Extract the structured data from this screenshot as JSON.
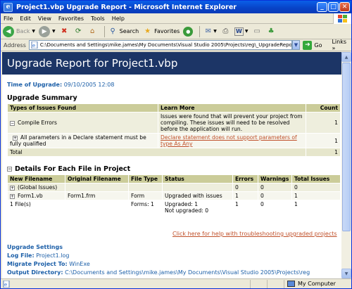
{
  "window": {
    "title": "Project1.vbp Upgrade Report - Microsoft Internet Explorer"
  },
  "menu": [
    "File",
    "Edit",
    "View",
    "Favorites",
    "Tools",
    "Help"
  ],
  "toolbar": {
    "back": "Back",
    "search": "Search",
    "favorites": "Favorites"
  },
  "address": {
    "label": "Address",
    "value": "C:\\Documents and Settings\\mike.james\\My Documents\\Visual Studio 2005\\Projects\\reg\\_UpgradeReport.htm",
    "go": "Go",
    "links": "Links"
  },
  "report": {
    "title": "Upgrade Report for Project1.vbp",
    "time_label": "Time of Upgrade:",
    "time_value": "09/10/2005 12:08",
    "summary_heading": "Upgrade Summary",
    "summary_headers": [
      "Types of Issues Found",
      "Learn More",
      "Count"
    ],
    "compile_errors_label": "Compile Errors",
    "compile_errors_desc": "Issues were found that will prevent your project from compiling. These issues will need to be resolved before the application will run.",
    "compile_errors_count": "1",
    "declare_issue": "All parameters in a Declare statement must be fully qualified",
    "declare_link": "Declare statement does not support parameters of type As Any",
    "declare_count": "1",
    "total_label": "Total",
    "total_count": "1",
    "details_heading": "Details For Each File in Project",
    "details_headers": [
      "New Filename",
      "Original Filename",
      "File Type",
      "Status",
      "Errors",
      "Warnings",
      "Total Issues"
    ],
    "global_row": {
      "name": "(Global Issues)",
      "errors": "0",
      "warnings": "0",
      "total": "0"
    },
    "form_row": {
      "name": "Form1.vb",
      "original": "Form1.frm",
      "type": "Form",
      "status": "Upgraded with issues",
      "errors": "1",
      "warnings": "0",
      "total": "1"
    },
    "files_row": {
      "name": "1 File(s)",
      "type": "Forms: 1",
      "status1": "Upgraded: 1",
      "status2": "Not upgraded: 0",
      "errors": "1",
      "warnings": "0",
      "total": "1"
    },
    "help_link": "Click here for help with troubleshooting upgraded projects",
    "settings_heading": "Upgrade Settings",
    "log_label": "Log File:",
    "log_value": "Project1.log",
    "migrate_label": "Migrate Project To:",
    "migrate_value": "WinExe",
    "output_label": "Output Directory:",
    "output_value": "C:\\Documents and Settings\\mike.james\\My Documents\\Visual Studio 2005\\Projects\\reg"
  },
  "status": {
    "zone": "My Computer"
  }
}
